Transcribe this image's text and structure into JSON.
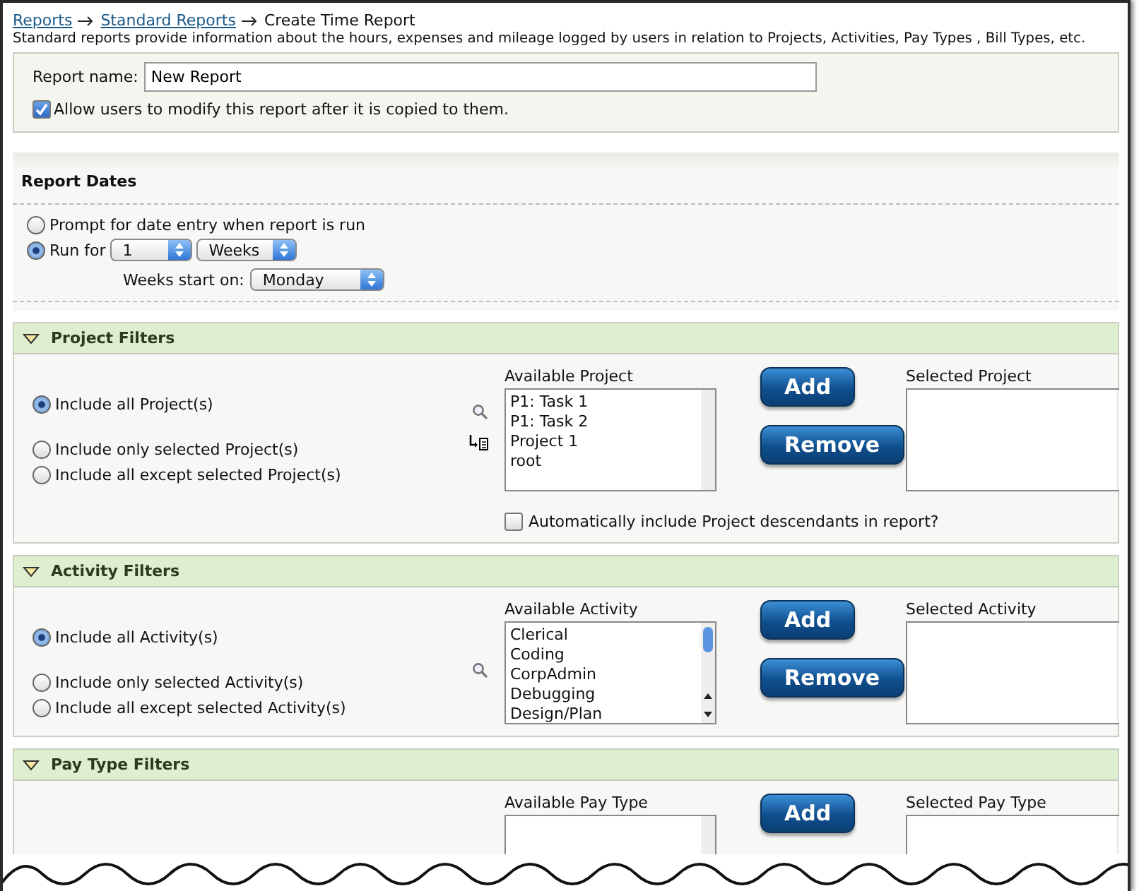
{
  "breadcrumb": [
    {
      "label": "Reports",
      "link": true
    },
    {
      "label": "Standard Reports",
      "link": true
    },
    {
      "label": "Create Time Report",
      "link": false
    }
  ],
  "description": "Standard reports provide information about the hours, expenses and mileage logged by users in relation to Projects, Activities, Pay Types , Bill Types, etc.",
  "report_name": {
    "label": "Report name:",
    "value": "New Report"
  },
  "allow_modify": {
    "label": "Allow users to modify this report after it is copied to them.",
    "checked": true
  },
  "report_dates": {
    "title": "Report Dates",
    "prompt": {
      "label": "Prompt for date entry when report is run",
      "selected": false
    },
    "run_for": {
      "label": "Run for",
      "selected": true,
      "count": "1",
      "unit": "Weeks"
    },
    "week_start": {
      "label": "Weeks start on:",
      "value": "Monday"
    }
  },
  "filters": [
    {
      "title": "Project Filters",
      "expanded": true,
      "options": [
        {
          "label": "Include all Project(s)",
          "selected": true
        },
        {
          "label": "Include only selected Project(s)",
          "selected": false
        },
        {
          "label": "Include all except selected Project(s)",
          "selected": false
        }
      ],
      "show_tree_icon": true,
      "available": {
        "label": "Available Project",
        "items": [
          "P1: Task 1",
          "P1: Task 2",
          "Project 1",
          "root"
        ]
      },
      "add": "Add",
      "remove": "Remove",
      "selected": {
        "label": "Selected Project"
      },
      "descendants": {
        "label": "Automatically include Project descendants in report?",
        "checked": false
      }
    },
    {
      "title": "Activity Filters",
      "expanded": true,
      "options": [
        {
          "label": "Include all Activity(s)",
          "selected": true
        },
        {
          "label": "Include only selected Activity(s)",
          "selected": false
        },
        {
          "label": "Include all except selected Activity(s)",
          "selected": false
        }
      ],
      "show_tree_icon": false,
      "available": {
        "label": "Available Activity",
        "items": [
          "Clerical",
          "Coding",
          "CorpAdmin",
          "Debugging",
          "Design/Plan"
        ]
      },
      "add": "Add",
      "remove": "Remove",
      "selected": {
        "label": "Selected Activity"
      }
    },
    {
      "title": "Pay Type Filters",
      "expanded": true,
      "available": {
        "label": "Available Pay Type"
      },
      "add": "Add",
      "selected": {
        "label": "Selected Pay Type"
      }
    }
  ]
}
